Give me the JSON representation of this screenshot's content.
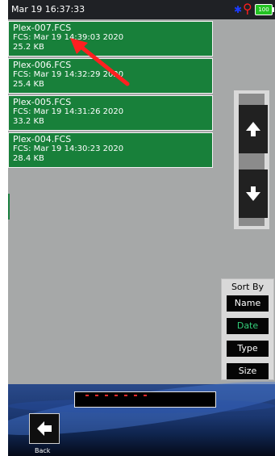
{
  "status_bar": {
    "time": "Mar 19 16:37:33",
    "battery": "100",
    "colors": {
      "background": "#1f2125",
      "bluetooth": "#1c3cff",
      "usb": "#ff1f1f",
      "battery": "#23c323"
    }
  },
  "file_list": {
    "items": [
      {
        "name": "Plex-007.FCS",
        "date": "FCS: Mar 19 14:39:03 2020",
        "size": "25.2 KB"
      },
      {
        "name": "Plex-006.FCS",
        "date": "FCS: Mar 19 14:32:29 2020",
        "size": "25.4 KB"
      },
      {
        "name": "Plex-005.FCS",
        "date": "FCS: Mar 19 14:31:26 2020",
        "size": "33.2 KB"
      },
      {
        "name": "Plex-004.FCS",
        "date": "FCS: Mar 19 14:30:23 2020",
        "size": "28.4 KB"
      }
    ],
    "colors": {
      "item_background": "#18803a",
      "text": "#ffffff"
    }
  },
  "sort_panel": {
    "title": "Sort By",
    "buttons": [
      {
        "label": "Name",
        "active": false
      },
      {
        "label": "Date",
        "active": true
      },
      {
        "label": "Type",
        "active": false
      },
      {
        "label": "Size",
        "active": false
      }
    ],
    "colors": {
      "active": "#33d07a"
    }
  },
  "navigation": {
    "back_label": "Back"
  },
  "icons": {
    "bluetooth": "bluetooth-icon",
    "usb": "usb-icon",
    "battery": "battery-icon",
    "scroll_up": "arrow-up-icon",
    "scroll_down": "arrow-down-icon",
    "back": "arrow-left-icon"
  }
}
